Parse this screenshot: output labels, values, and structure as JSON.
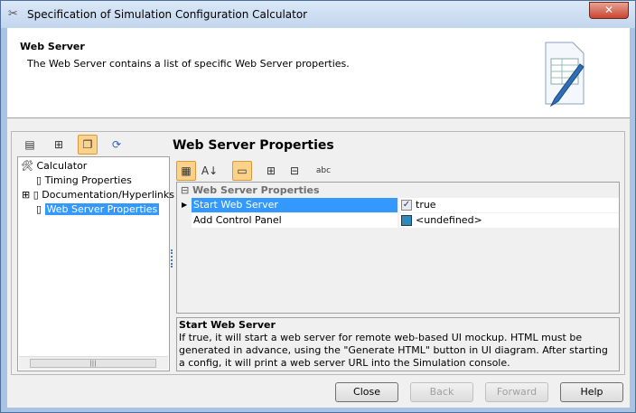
{
  "window": {
    "title": "Specification of Simulation Configuration Calculator",
    "close": "✕"
  },
  "header": {
    "title": "Web Server",
    "description": "The Web Server contains a list of specific Web Server properties."
  },
  "tree": {
    "root": "Calculator",
    "items": [
      {
        "label": "Timing Properties"
      },
      {
        "label": "Documentation/Hyperlinks"
      },
      {
        "label": "Web Server Properties",
        "selected": true
      }
    ]
  },
  "panel": {
    "title": "Web Server Properties",
    "group": "Web Server Properties",
    "rows": [
      {
        "name": "Start Web Server",
        "value": "true",
        "selected": true
      },
      {
        "name": "Add Control Panel",
        "value": "<undefined>"
      }
    ]
  },
  "description": {
    "title": "Start Web Server",
    "text": "If true, it will start a web server for remote web-based UI mockup. HTML must be generated in advance, using the \"Generate HTML\" button in UI diagram. After starting a config, it will print a web server URL into the Simulation console."
  },
  "buttons": {
    "close": "Close",
    "back": "Back",
    "forward": "Forward",
    "help": "Help"
  },
  "toolbar": {
    "abc": "abc"
  }
}
